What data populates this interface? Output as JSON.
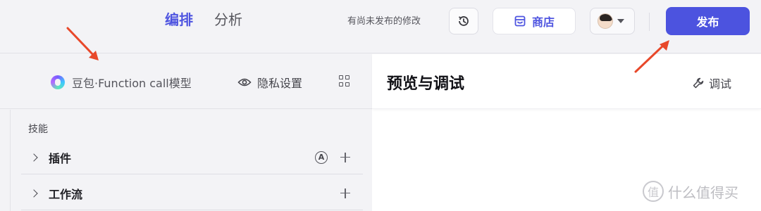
{
  "tabs": {
    "edit": "编排",
    "analyze": "分析"
  },
  "status": {
    "unsaved": "有尚未发布的修改"
  },
  "toolbar": {
    "store_label": "商店",
    "publish_label": "发布"
  },
  "left_panel": {
    "model_name": "豆包·Function call模型",
    "privacy_label": "隐私设置",
    "section_title": "技能",
    "skills": [
      {
        "label": "插件",
        "has_auto_badge": true,
        "badge": "A"
      },
      {
        "label": "工作流",
        "has_auto_badge": false
      }
    ]
  },
  "right_panel": {
    "title": "预览与调试",
    "debug_label": "调试"
  },
  "watermark": {
    "text": "什么值得买",
    "mark": "值"
  },
  "colors": {
    "accent": "#4f55e0",
    "publish_bg": "#4c53df",
    "annotation_arrow": "#e8482a"
  }
}
